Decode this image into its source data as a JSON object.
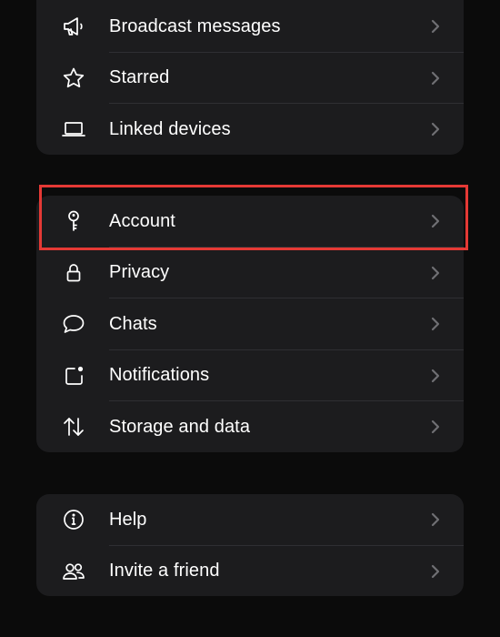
{
  "settings": {
    "group1": [
      {
        "label": "Broadcast messages",
        "icon": "megaphone-icon"
      },
      {
        "label": "Starred",
        "icon": "star-icon"
      },
      {
        "label": "Linked devices",
        "icon": "laptop-icon"
      }
    ],
    "group2": [
      {
        "label": "Account",
        "icon": "key-icon"
      },
      {
        "label": "Privacy",
        "icon": "lock-icon"
      },
      {
        "label": "Chats",
        "icon": "chat-bubble-icon"
      },
      {
        "label": "Notifications",
        "icon": "notification-badge-icon"
      },
      {
        "label": "Storage and data",
        "icon": "up-down-arrows-icon"
      }
    ],
    "group3": [
      {
        "label": "Help",
        "icon": "info-icon"
      },
      {
        "label": "Invite a friend",
        "icon": "people-icon"
      }
    ]
  },
  "colors": {
    "background": "#0b0b0b",
    "card": "#1c1c1e",
    "text": "#ffffff",
    "chevron": "#6f6f73",
    "highlight": "#e53935"
  },
  "highlighted_item": "Account"
}
